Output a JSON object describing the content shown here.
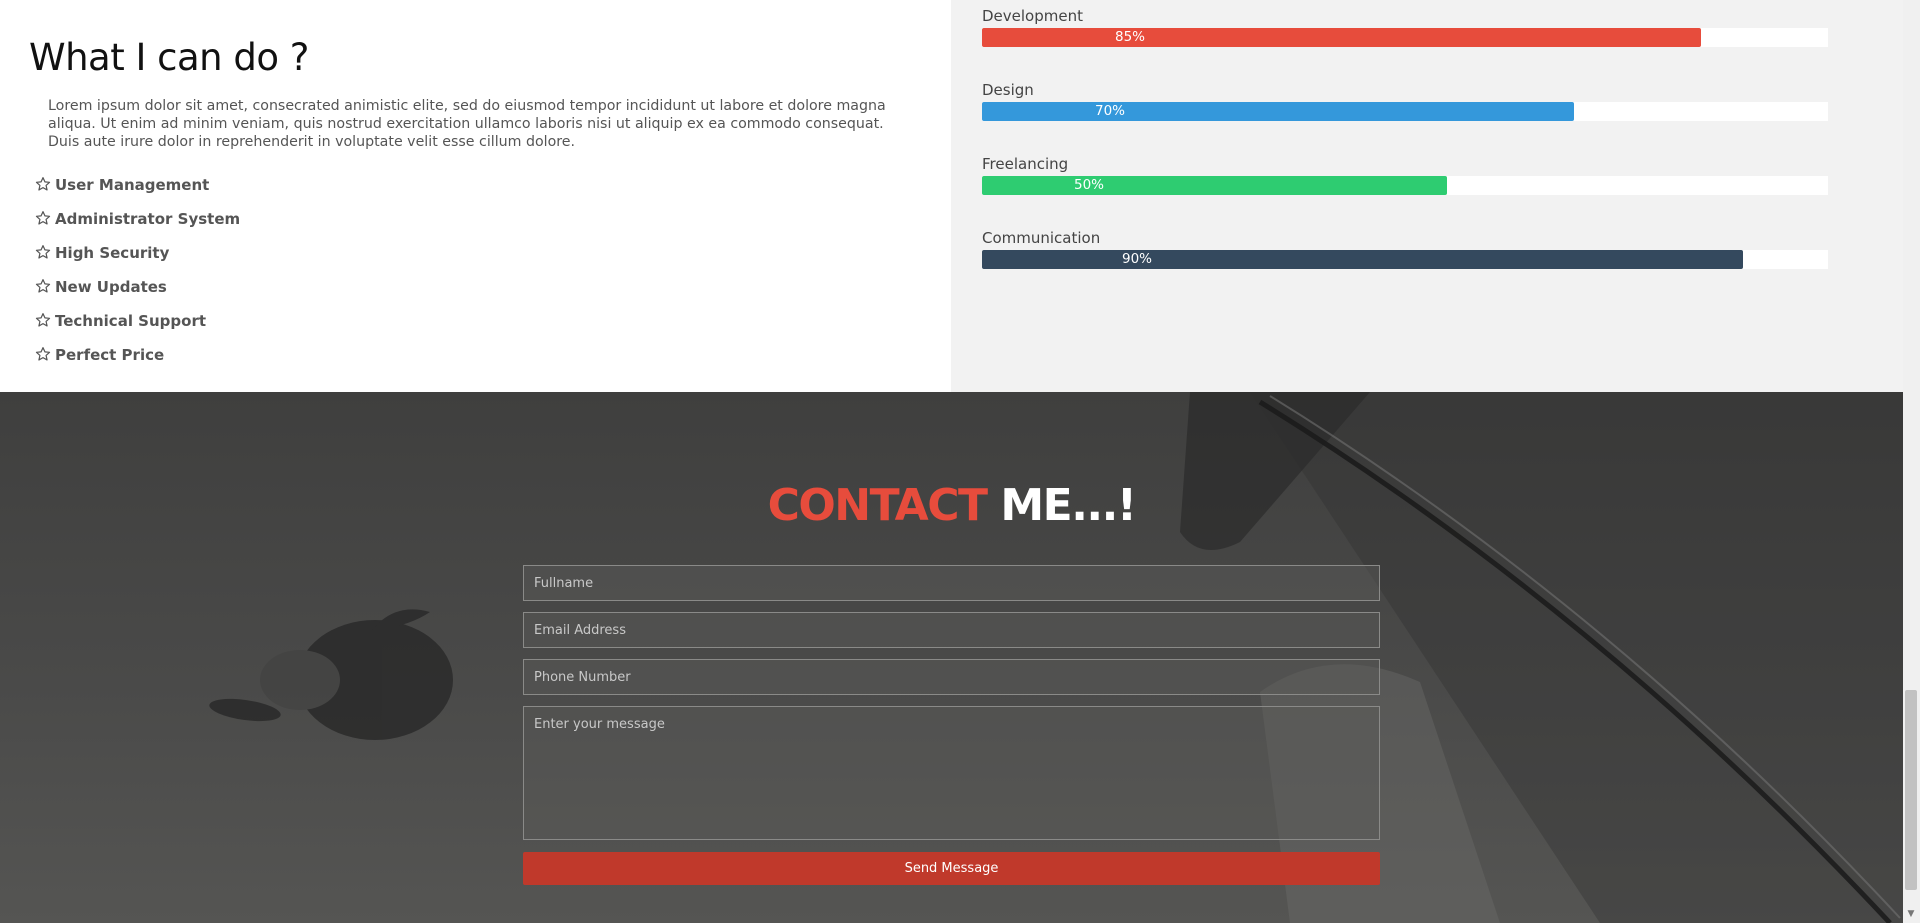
{
  "skills_section": {
    "heading": "What I can do ?",
    "intro": "Lorem ipsum dolor sit amet, consecrated animistic elite, sed do eiusmod tempor incididunt ut labore et dolore magna aliqua. Ut enim ad minim veniam, quis nostrud exercitation ullamco laboris nisi ut aliquip ex ea commodo consequat. Duis aute irure dolor in reprehenderit in voluptate velit esse cillum dolore.",
    "features": [
      {
        "label": "User Management",
        "icon": "star-outline-icon"
      },
      {
        "label": "Administrator System",
        "icon": "star-outline-icon"
      },
      {
        "label": "High Security",
        "icon": "star-outline-icon"
      },
      {
        "label": "New Updates",
        "icon": "star-outline-icon"
      },
      {
        "label": "Technical Support",
        "icon": "star-outline-icon"
      },
      {
        "label": "Perfect Price",
        "icon": "star-outline-icon"
      }
    ]
  },
  "skill_bars": [
    {
      "label": "Development",
      "percent_text": "85%",
      "progress": 0.85,
      "color": "#e74c3c"
    },
    {
      "label": "Design",
      "percent_text": "70%",
      "progress": 0.7,
      "color": "#3498db"
    },
    {
      "label": "Freelancing",
      "percent_text": "50%",
      "progress": 0.55,
      "color": "#2ecc71"
    },
    {
      "label": "Communication",
      "percent_text": "90%",
      "progress": 0.9,
      "color": "#34495e"
    }
  ],
  "contact": {
    "title_accent": "CONTACT",
    "title_rest": "ME...!",
    "accent_color": "#e74c3c",
    "fullname_placeholder": "Fullname",
    "email_placeholder": "Email Address",
    "phone_placeholder": "Phone Number",
    "message_placeholder": "Enter your message",
    "send_label": "Send Message",
    "button_color": "#c0392b"
  }
}
